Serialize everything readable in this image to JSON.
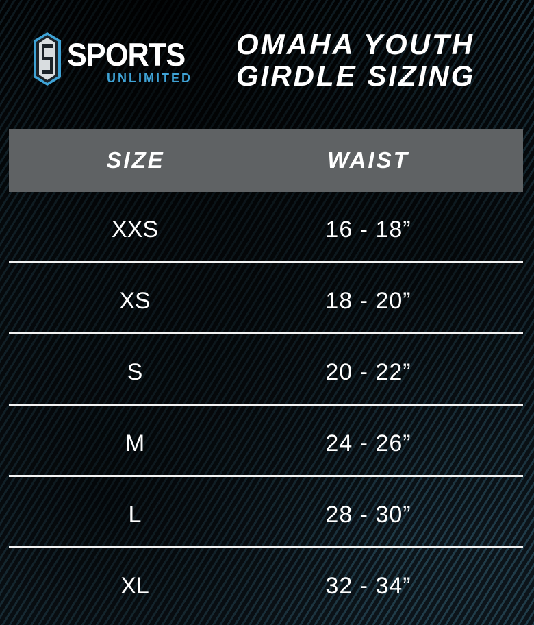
{
  "brand": {
    "word": "SPORTS",
    "sub": "UNLIMITED",
    "accent_color": "#3fa3d6",
    "icon": "shield-s-logo-icon"
  },
  "title": {
    "line1": "OMAHA YOUTH",
    "line2": "GIRDLE SIZING"
  },
  "table": {
    "headers": {
      "size": "SIZE",
      "waist": "WAIST"
    },
    "rows": [
      {
        "size": "XXS",
        "waist": "16 - 18”"
      },
      {
        "size": "XS",
        "waist": "18 - 20”"
      },
      {
        "size": "S",
        "waist": "20 - 22”"
      },
      {
        "size": "M",
        "waist": "24 - 26”"
      },
      {
        "size": "L",
        "waist": "28 - 30”"
      },
      {
        "size": "XL",
        "waist": "32 - 34”"
      }
    ]
  }
}
